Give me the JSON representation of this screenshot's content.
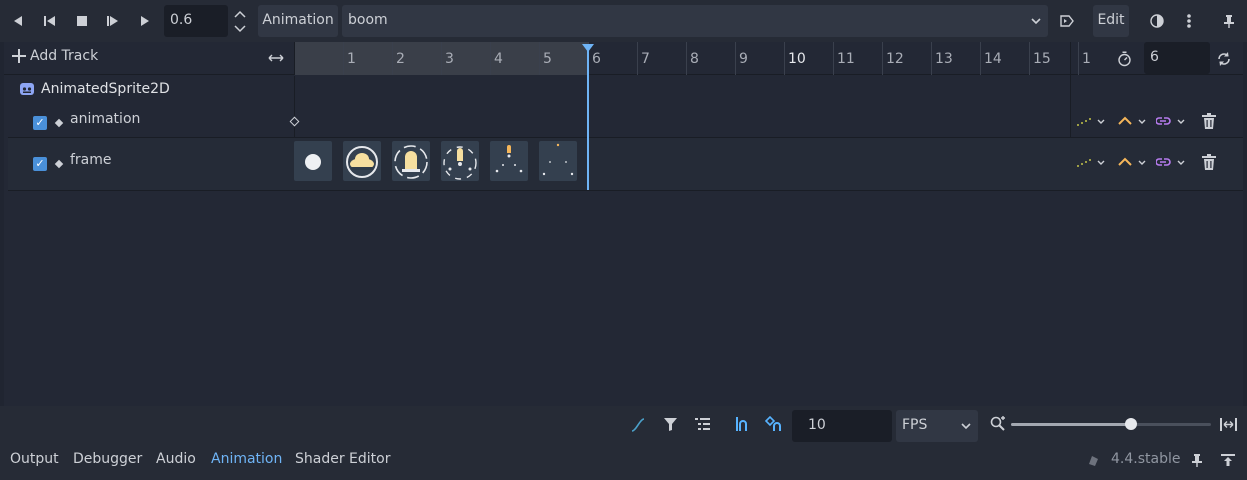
{
  "toolbar": {
    "position_value": "0.6",
    "animation_label": "Animation",
    "animation_name": "boom",
    "edit_label": "Edit"
  },
  "track_header": {
    "add_track_label": "Add Track",
    "ruler_ticks": [
      "1",
      "2",
      "3",
      "4",
      "5",
      "6",
      "7",
      "8",
      "9",
      "10",
      "11",
      "12",
      "13",
      "14",
      "15",
      "1"
    ],
    "length_value": "6"
  },
  "tracks": {
    "node_name": "AnimatedSprite2D",
    "animation_track": "animation",
    "frame_track": "frame"
  },
  "bottom": {
    "snap_value": "10",
    "snap_mode": "FPS"
  },
  "tabs": {
    "output": "Output",
    "debugger": "Debugger",
    "audio": "Audio",
    "animation": "Animation",
    "shader_editor": "Shader Editor",
    "version": "4.4.stable"
  },
  "colors": {
    "accent": "#57b3ff",
    "active_tab": "#6fb4f6",
    "playhead": "#6fb4f6",
    "interp_yellow": "#c4c44a",
    "interp_orange": "#f5b65a",
    "loop_purple": "#b87cf0"
  }
}
